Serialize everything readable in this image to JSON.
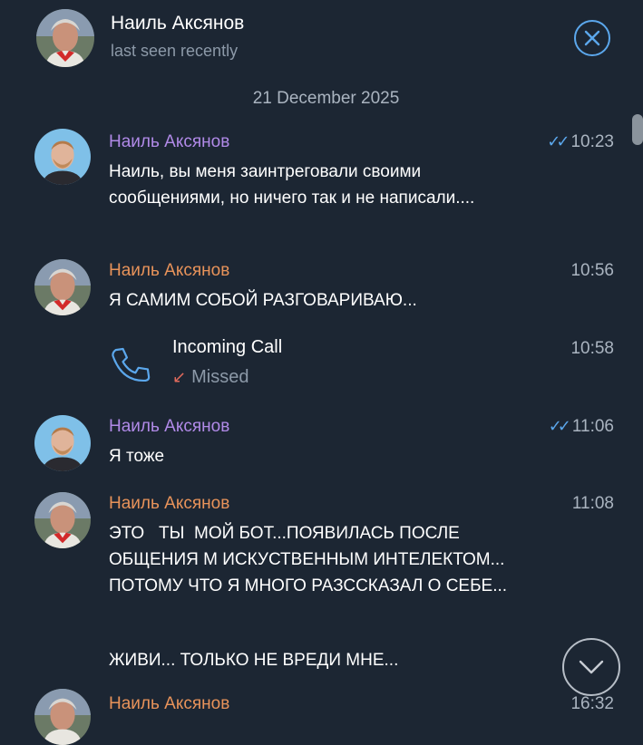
{
  "header": {
    "name": "Наиль Аксянов",
    "status": "last seen recently"
  },
  "date_separator": "21 December 2025",
  "messages": [
    {
      "sender": "Наиль Аксянов",
      "time": "10:23",
      "read_ticks": "✓✓",
      "text": "Наиль, вы меня заинтреговали своими сообщениями, но ничего так и не написали...."
    },
    {
      "sender": "Наиль Аксянов",
      "time": "10:56",
      "text": "Я САМИМ СОБОЙ РАЗГОВАРИВАЮ..."
    },
    {
      "sender": "Наиль Аксянов",
      "time": "11:06",
      "read_ticks": "✓✓",
      "text": "Я тоже"
    },
    {
      "sender": "Наиль Аксянов",
      "time": "11:08",
      "text": "ЭТО   ТЫ  МОЙ БОТ...ПОЯВИЛАСЬ ПОСЛЕ ОБЩЕНИЯ М ИСКУСТВЕННЫМ ИНТЕЛЕКТОМ... ПОТОМУ ЧТО Я МНОГО РАЗССКАЗАЛ О СЕБЕ...",
      "text2": "ЖИВИ... ТОЛЬКО НЕ ВРЕДИ МНЕ..."
    },
    {
      "sender": "Наиль Аксянов",
      "time": "16:32"
    }
  ],
  "call": {
    "title": "Incoming Call",
    "status": "Missed",
    "time": "10:58"
  },
  "colors": {
    "background": "#1c2633",
    "accent_blue": "#5ba7ec",
    "sender_purple": "#b18ae8",
    "sender_orange": "#e8935a",
    "missed_red": "#e06a5c"
  },
  "icons": {
    "close": "close-circle-icon",
    "phone": "phone-icon",
    "missed_arrow": "missed-call-arrow-icon",
    "scroll_down": "chevron-down-icon",
    "read": "double-check-icon"
  }
}
